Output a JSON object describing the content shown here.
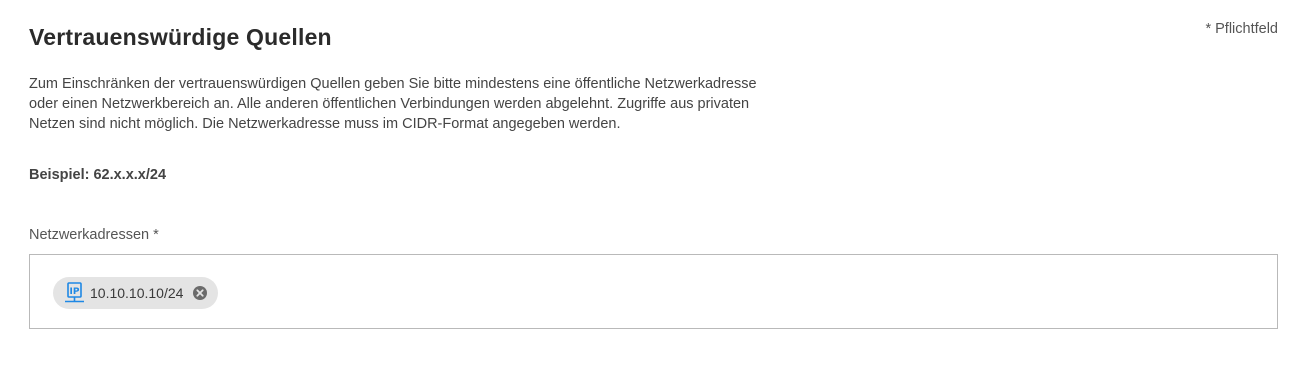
{
  "section": {
    "title": "Vertrauenswürdige Quellen",
    "required_note": "* Pflichtfeld",
    "description": "Zum Einschränken der vertrauenswürdigen Quellen geben Sie bitte mindestens eine öffentliche Netzwerkadresse oder einen Netzwerkbereich an. Alle anderen öffentlichen Verbindungen werden abgelehnt. Zugriffe aus privaten Netzen sind nicht möglich. Die Netzwerkadresse muss im CIDR-Format angegeben werden.",
    "example": "Beispiel: 62.x.x.x/24"
  },
  "network_field": {
    "label": "Netzwerkadressen *",
    "tags": [
      {
        "icon": "ip-network-icon",
        "value": "10.10.10.10/24",
        "remove_icon": "close-circle-icon"
      }
    ]
  },
  "colors": {
    "icon_blue": "#1e88e5",
    "chip_background": "#e4e4e4",
    "border": "#b9b9b9"
  }
}
